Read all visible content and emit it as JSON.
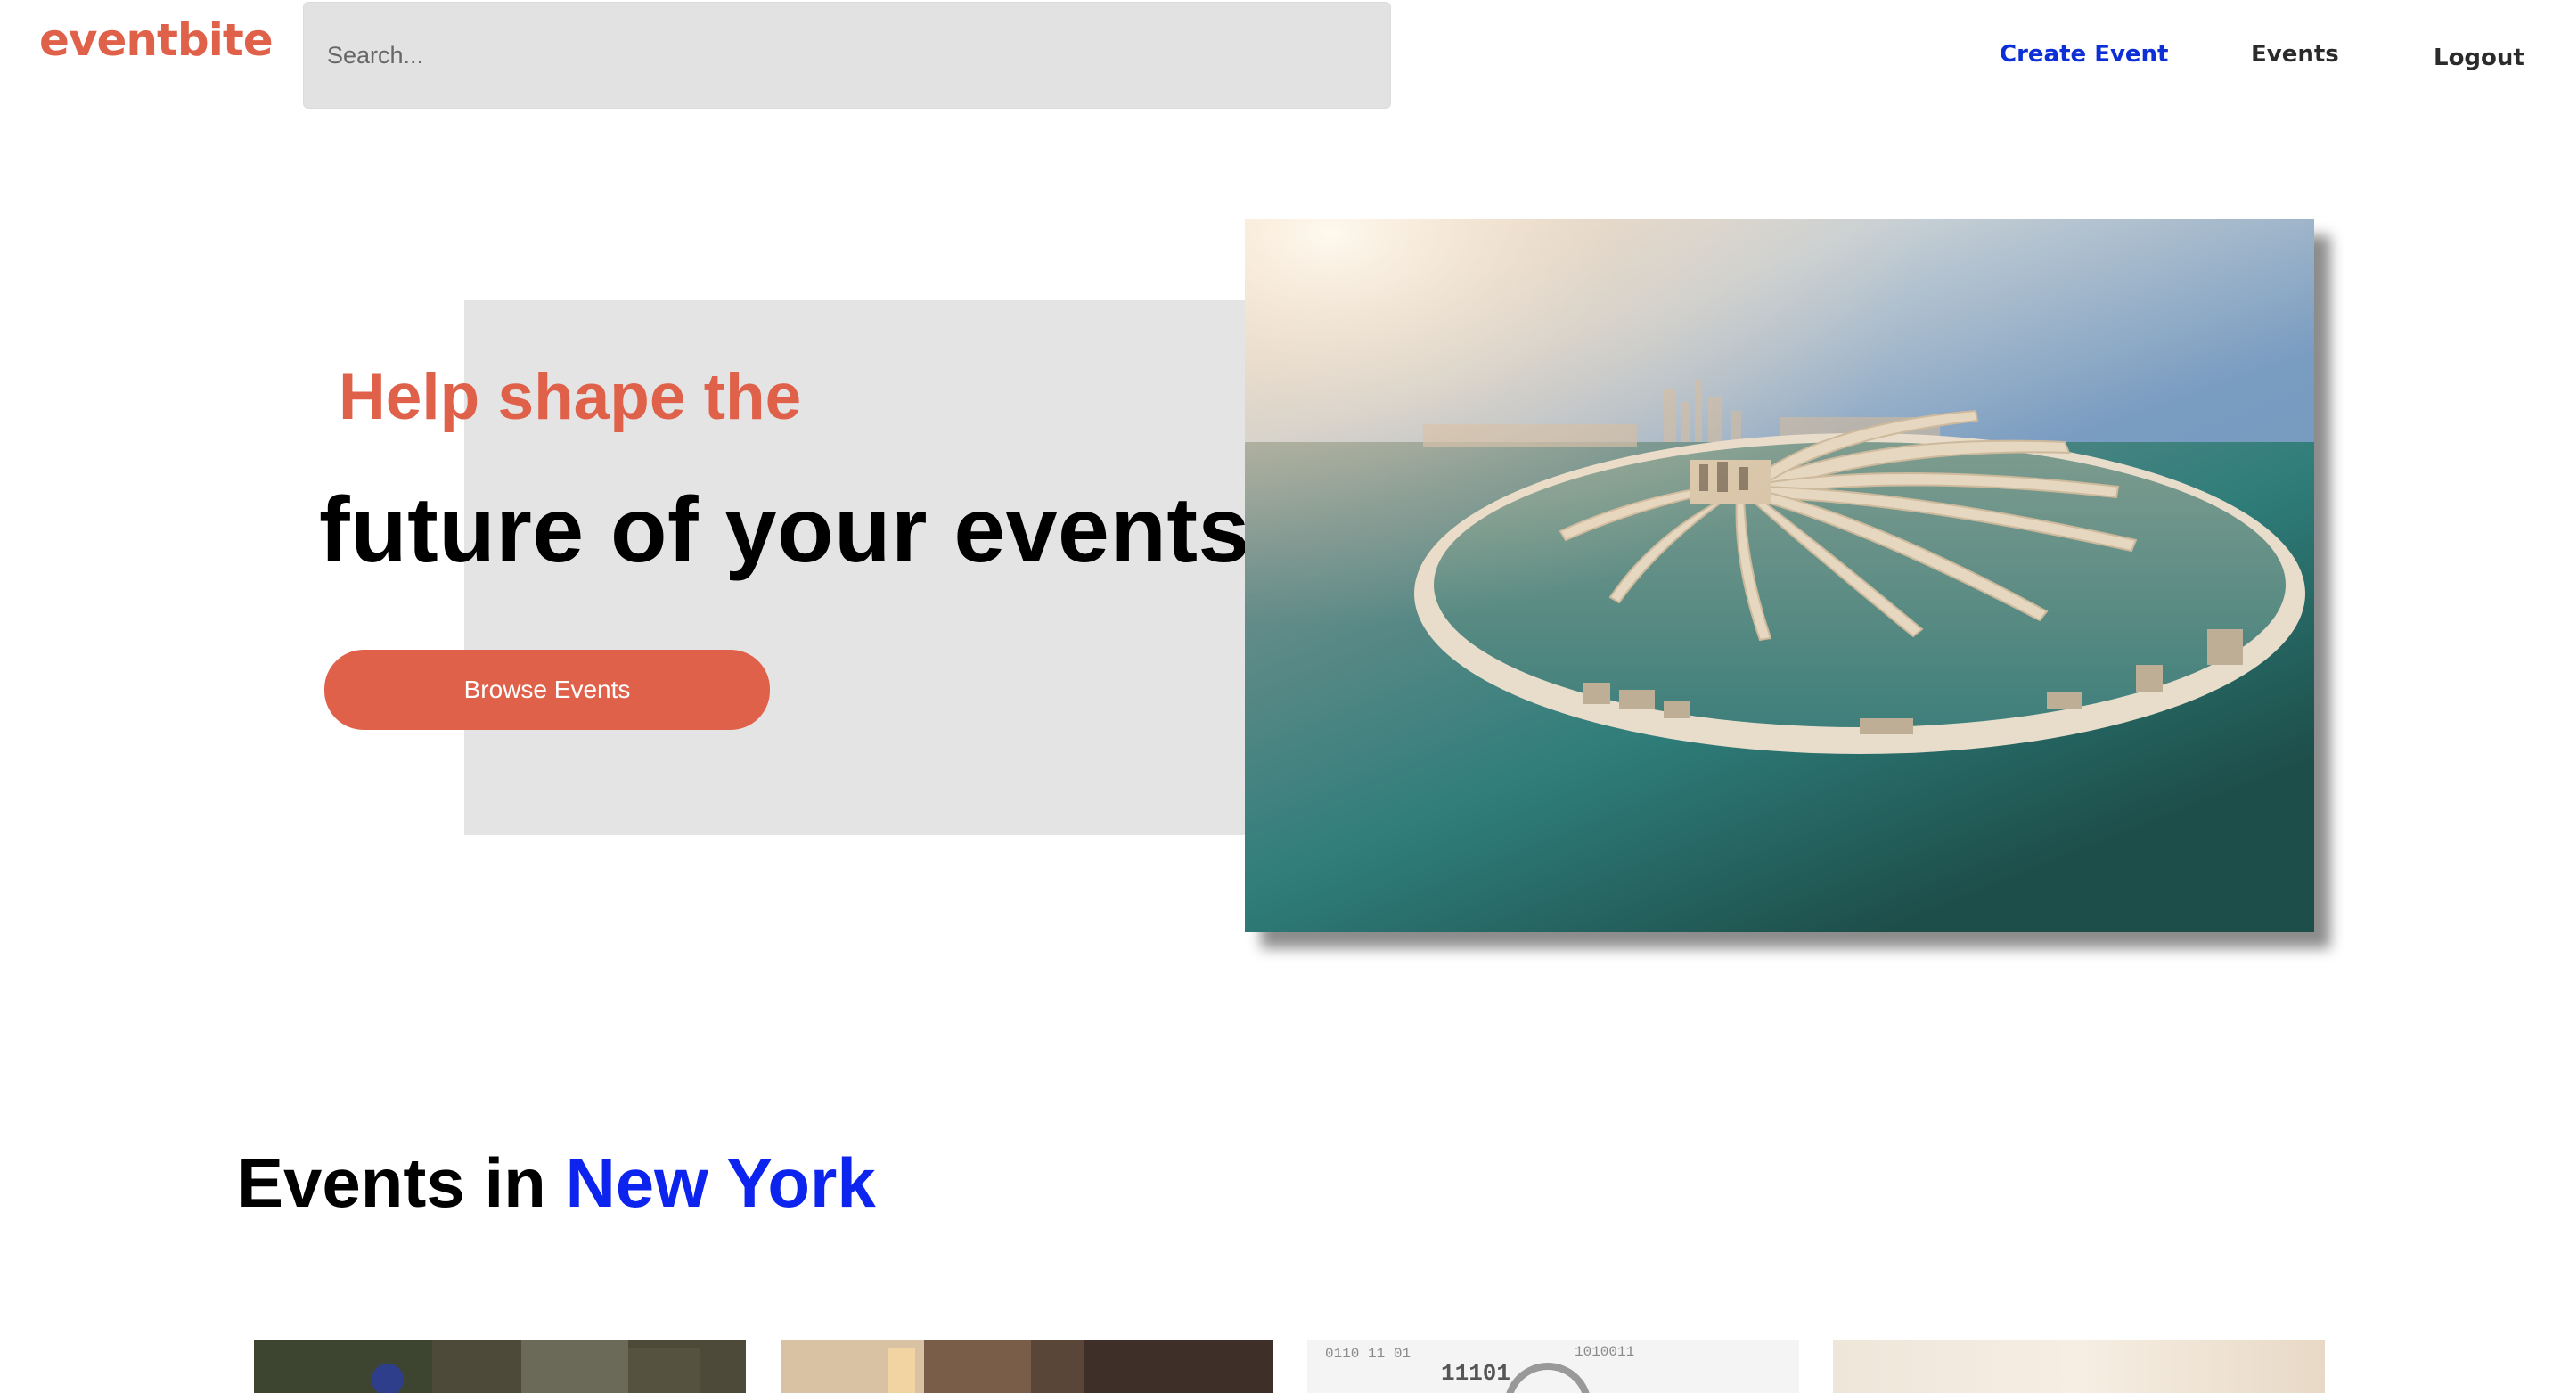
{
  "header": {
    "logo": "eventbite",
    "search_placeholder": "Search...",
    "nav": {
      "create_event": "Create Event",
      "events": "Events",
      "logout": "Logout"
    }
  },
  "hero": {
    "subtitle": "Help shape the",
    "title": "future of your events",
    "browse_button": "Browse Events"
  },
  "events_section": {
    "title_prefix": "Events in",
    "city": "New York",
    "cards": [
      {
        "theme": "outdoor-gathering"
      },
      {
        "theme": "indoor-venue"
      },
      {
        "theme": "binary-tech"
      },
      {
        "theme": "bright-abstract"
      }
    ],
    "card3_overlay_text": "11101"
  },
  "colors": {
    "brand": "#e0614a",
    "link_blue": "#0d2fd6",
    "city_blue": "#0d24ef",
    "search_bg": "#e3e2e3",
    "hero_bg": "#e5e4e5"
  }
}
